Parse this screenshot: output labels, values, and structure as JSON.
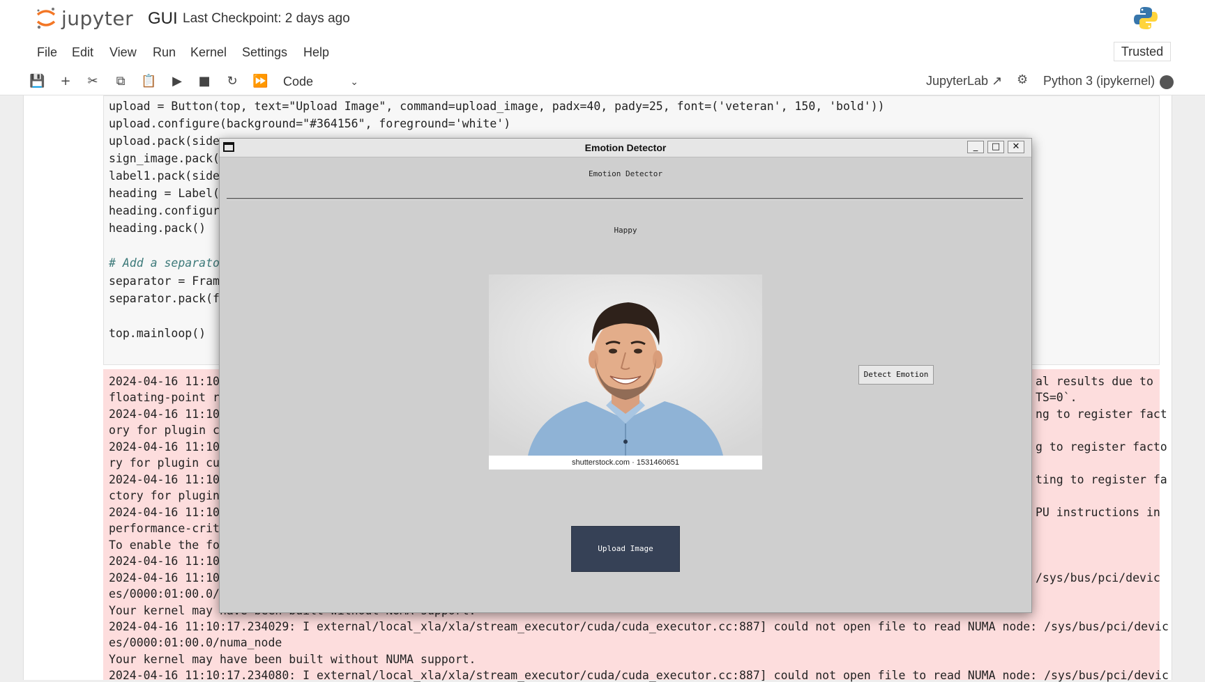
{
  "header": {
    "logo_text": "jupyter",
    "notebook_title": "GUI",
    "checkpoint": "Last Checkpoint: 2 days ago"
  },
  "menu": [
    "File",
    "Edit",
    "View",
    "Run",
    "Kernel",
    "Settings",
    "Help"
  ],
  "trusted_label": "Trusted",
  "toolbar": {
    "cell_type": "Code",
    "jupyterlab_link": "JupyterLab",
    "kernel_name": "Python 3 (ipykernel)"
  },
  "code_lines": [
    "upload = Button(top, text=\"Upload Image\", command=upload_image, padx=40, pady=25, font=('veteran', 150, 'bold'))",
    "upload.configure(background=\"#364156\", foreground='white')",
    "upload.pack(side",
    "sign_image.pack(",
    "label1.pack(side",
    "heading = Label(",
    "heading.configur",
    "heading.pack()",
    "",
    "# Add a separato",
    "separator = Fram",
    "separator.pack(f",
    "",
    "top.mainloop()"
  ],
  "stderr_lines": [
    "2024-04-16 11:10",
    "floating-point r",
    "2024-04-16 11:10",
    "ory for plugin c",
    "2024-04-16 11:10",
    "ry for plugin cu",
    "2024-04-16 11:10",
    "ctory for plugin",
    "2024-04-16 11:10",
    "performance-crit",
    "To enable the fo",
    "2024-04-16 11:10",
    "2024-04-16 11:10",
    "es/0000:01:00.0/",
    "Your kernel may have been built without NUMA support.",
    "2024-04-16 11:10:17.234029: I external/local_xla/xla/stream_executor/cuda/cuda_executor.cc:887] could not open file to read NUMA node: /sys/bus/pci/devic",
    "es/0000:01:00.0/numa_node",
    "Your kernel may have been built without NUMA support.",
    "2024-04-16 11:10:17.234080: I external/local_xla/xla/stream_executor/cuda/cuda_executor.cc:887] could not open file to read NUMA node: /sys/bus/pci/devic"
  ],
  "stderr_right": [
    "al results due to",
    "TS=0`.",
    "ng to register fact",
    "g to register facto",
    "ting to register fa",
    "PU instructions in",
    "/sys/bus/pci/devic"
  ],
  "tk_window": {
    "title": "Emotion Detector",
    "heading": "Emotion Detector",
    "label1": "Happy",
    "image_caption": "shutterstock.com · 1531460651",
    "detect_button": "Detect Emotion",
    "upload_button": "Upload Image",
    "upload_bg": "#364156",
    "upload_fg": "#ffffff"
  },
  "colors": {
    "stderr_bg": "#fddddd",
    "accent_orange": "#f37726"
  }
}
